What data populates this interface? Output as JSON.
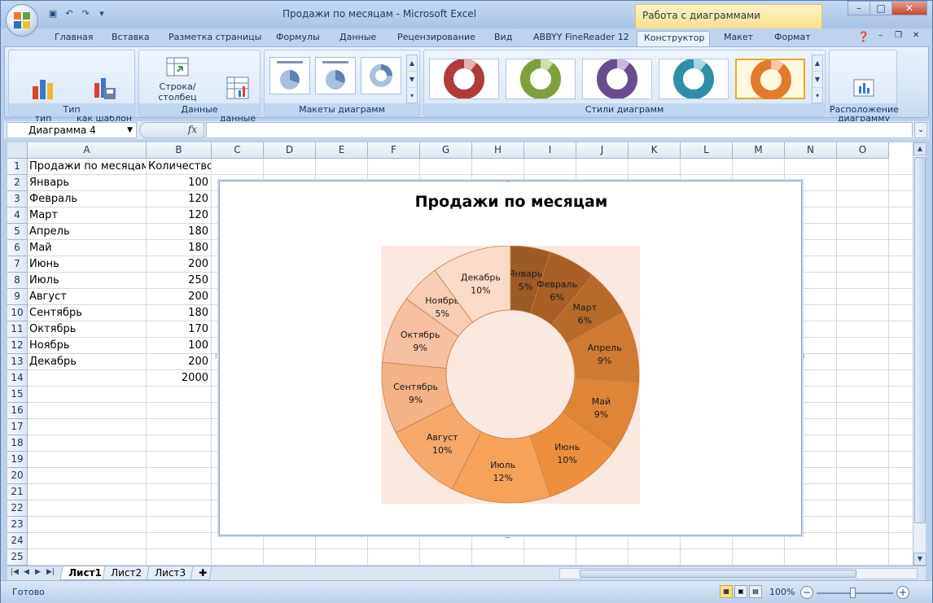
{
  "window": {
    "title": "Продажи по месяцам - Microsoft Excel",
    "context_tab": "Работа с диаграммами",
    "controls": [
      "–",
      "□",
      "✕"
    ]
  },
  "tabs": [
    "Главная",
    "Вставка",
    "Разметка страницы",
    "Формулы",
    "Данные",
    "Рецензирование",
    "Вид",
    "ABBYY FineReader 12",
    "Конструктор",
    "Макет",
    "Формат"
  ],
  "active_tab": "Конструктор",
  "ribbon": {
    "type_group": {
      "label": "Тип",
      "change_type": "Изменить тип\nдиаграммы",
      "save_template": "Сохранить\nкак шаблон"
    },
    "data_group": {
      "label": "Данные",
      "switch_row_col": "Строка/столбец",
      "select_data": "Выбрать\nданные"
    },
    "layouts_group": {
      "label": "Макеты диаграмм"
    },
    "styles_group": {
      "label": "Стили диаграмм",
      "style_colors": [
        "#b13a3a",
        "#7ea03b",
        "#6a4d8e",
        "#2f8fa8",
        "#e07a2d"
      ]
    },
    "location_group": {
      "label": "Расположение",
      "move_chart": "Переместить\nдиаграмму"
    }
  },
  "formula_bar": {
    "name_box": "Диаграмма 4",
    "fx": "fx",
    "value": ""
  },
  "sheet": {
    "columns": [
      "A",
      "B",
      "C",
      "D",
      "E",
      "F",
      "G",
      "H",
      "I",
      "J",
      "K",
      "L",
      "M",
      "N",
      "O"
    ],
    "rows": [
      "1",
      "2",
      "3",
      "4",
      "5",
      "6",
      "7",
      "8",
      "9",
      "10",
      "11",
      "12",
      "13",
      "14",
      "15",
      "16",
      "17",
      "18",
      "19",
      "20",
      "21",
      "22",
      "23",
      "24",
      "25"
    ],
    "header": {
      "a": "Продажи по месяцам",
      "b": "Количество"
    },
    "data": [
      {
        "month": "Январь",
        "qty": "100"
      },
      {
        "month": "Февраль",
        "qty": "120"
      },
      {
        "month": "Март",
        "qty": "120"
      },
      {
        "month": "Апрель",
        "qty": "180"
      },
      {
        "month": "Май",
        "qty": "180"
      },
      {
        "month": "Июнь",
        "qty": "200"
      },
      {
        "month": "Июль",
        "qty": "250"
      },
      {
        "month": "Август",
        "qty": "200"
      },
      {
        "month": "Сентябрь",
        "qty": "180"
      },
      {
        "month": "Октябрь",
        "qty": "170"
      },
      {
        "month": "Ноябрь",
        "qty": "100"
      },
      {
        "month": "Декабрь",
        "qty": "200"
      }
    ],
    "total": "2000"
  },
  "chart_data": {
    "type": "pie",
    "variant": "doughnut",
    "title": "Продажи по месяцам",
    "categories": [
      "Январь",
      "Февраль",
      "Март",
      "Апрель",
      "Май",
      "Июнь",
      "Июль",
      "Август",
      "Сентябрь",
      "Октябрь",
      "Ноябрь",
      "Декабрь"
    ],
    "values": [
      100,
      120,
      120,
      180,
      180,
      200,
      250,
      200,
      180,
      170,
      100,
      200
    ],
    "labels_pct": [
      "5%",
      "6%",
      "6%",
      "9%",
      "9%",
      "10%",
      "12%",
      "10%",
      "9%",
      "9%",
      "5%",
      "10%"
    ],
    "colors": [
      "#9c5a24",
      "#a95f25",
      "#b86a2a",
      "#cf7a33",
      "#de8437",
      "#ec903f",
      "#f6a25a",
      "#f5a86a",
      "#f5b284",
      "#f7c0a0",
      "#f8cdb3",
      "#fadac8"
    ],
    "plot_background": "#fbe8de"
  },
  "sheet_tabs": [
    "Лист1",
    "Лист2",
    "Лист3"
  ],
  "active_sheet": "Лист1",
  "status": {
    "ready": "Готово",
    "zoom": "100%"
  }
}
